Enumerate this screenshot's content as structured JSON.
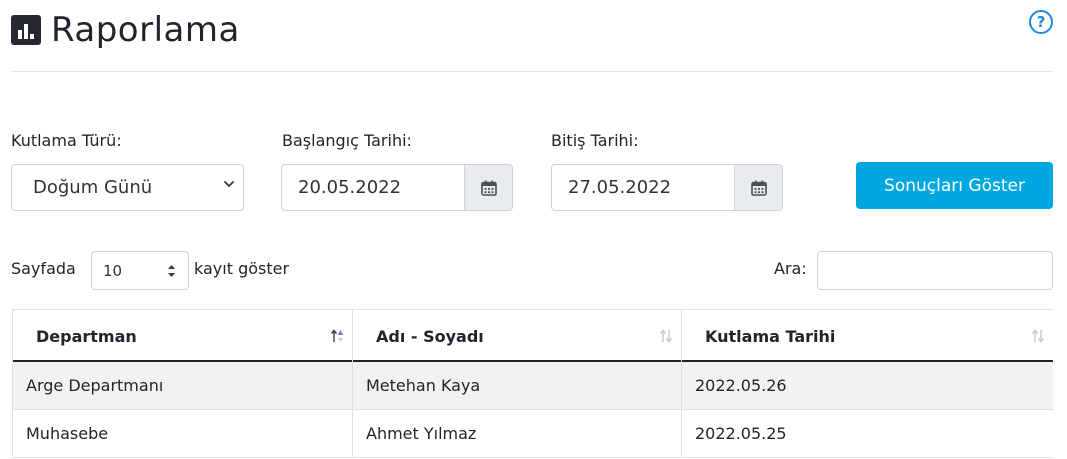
{
  "header": {
    "title": "Raporlama",
    "help_icon": "?"
  },
  "filters": {
    "type_label": "Kutlama Türü:",
    "type_value": "Doğum Günü",
    "start_label": "Başlangıç Tarihi:",
    "start_value": "20.05.2022",
    "end_label": "Bitiş Tarihi:",
    "end_value": "27.05.2022",
    "submit_label": "Sonuçları Göster"
  },
  "table_controls": {
    "prefix": "Sayfada",
    "page_size": "10",
    "suffix": "kayıt göster",
    "search_label": "Ara:",
    "search_value": ""
  },
  "table": {
    "columns": [
      "Departman",
      "Adı - Soyadı",
      "Kutlama Tarihi"
    ],
    "rows": [
      [
        "Arge Departmanı",
        "Metehan Kaya",
        "2022.05.26"
      ],
      [
        "Muhasebe",
        "Ahmet Yılmaz",
        "2022.05.25"
      ]
    ]
  },
  "colors": {
    "accent": "#00a7e1",
    "help": "#1e88e5"
  }
}
